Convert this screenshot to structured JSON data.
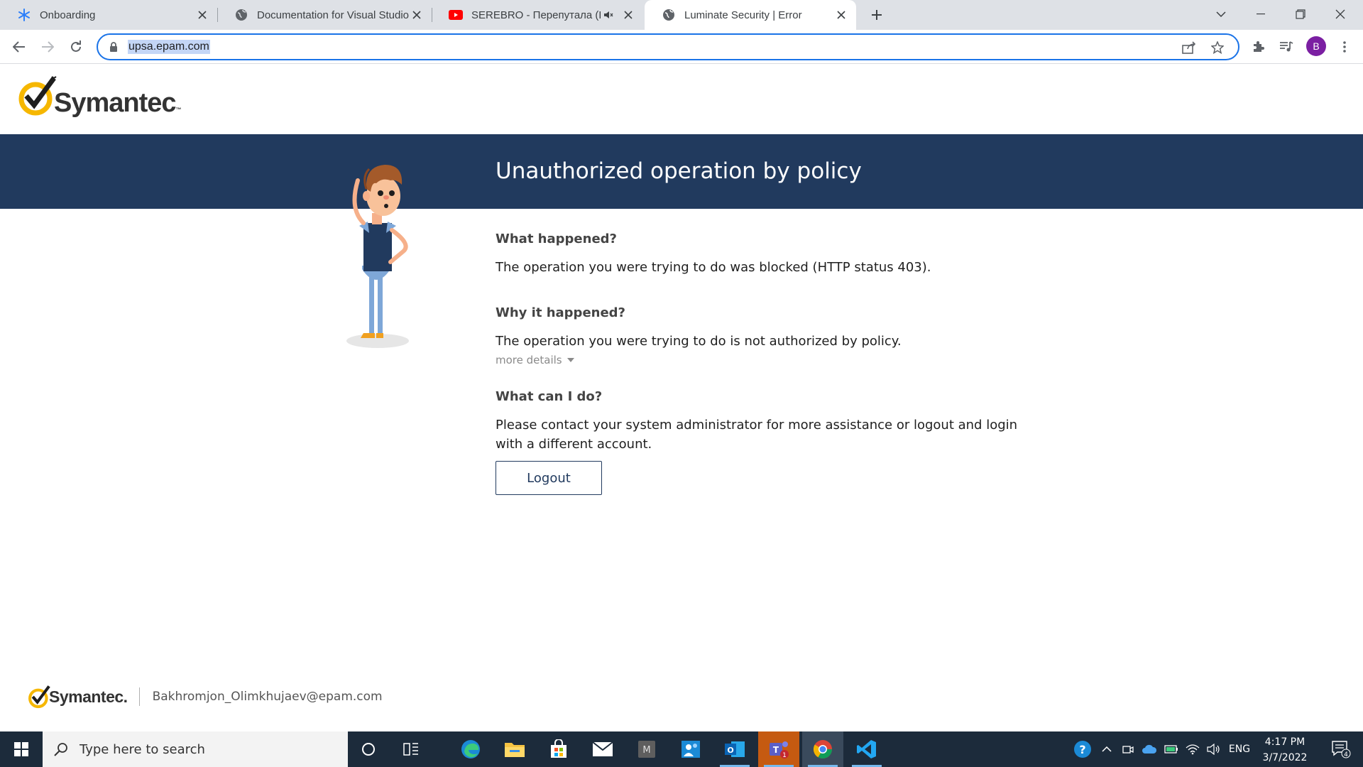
{
  "browser": {
    "tabs": [
      {
        "title": "Onboarding",
        "icon": "onboarding-icon"
      },
      {
        "title": "Documentation for Visual Studio",
        "icon": "globe-icon"
      },
      {
        "title": "SEREBRO - Перепутала (LIVE",
        "icon": "youtube-icon",
        "muted": true
      },
      {
        "title": "Luminate Security | Error",
        "icon": "globe-icon",
        "active": true
      }
    ],
    "url": "upsa.epam.com",
    "profile_initial": "B"
  },
  "page": {
    "brand": "Symantec",
    "brand_tm": "™",
    "banner_title": "Unauthorized operation by policy",
    "sections": {
      "what_happened": {
        "question": "What happened?",
        "answer": "The operation you were trying to do was blocked (HTTP status 403)."
      },
      "why_happened": {
        "question": "Why it happened?",
        "answer": "The operation you were trying to do is not authorized by policy.",
        "more_details": "more details"
      },
      "what_can_i_do": {
        "question": "What can I do?",
        "answer": "Please contact your system administrator for more assistance or logout and login with a different account."
      }
    },
    "logout_label": "Logout",
    "footer": {
      "brand": "Symantec.",
      "user": "Bakhromjon_Olimkhujaev@epam.com"
    }
  },
  "taskbar": {
    "search_placeholder": "Type here to search",
    "language": "ENG",
    "time": "4:17 PM",
    "date": "3/7/2022",
    "teams_badge": "1",
    "notification_count": "4"
  },
  "colors": {
    "banner": "#213a5e",
    "accent": "#1a73e8",
    "taskbar": "#1c2b3b"
  }
}
